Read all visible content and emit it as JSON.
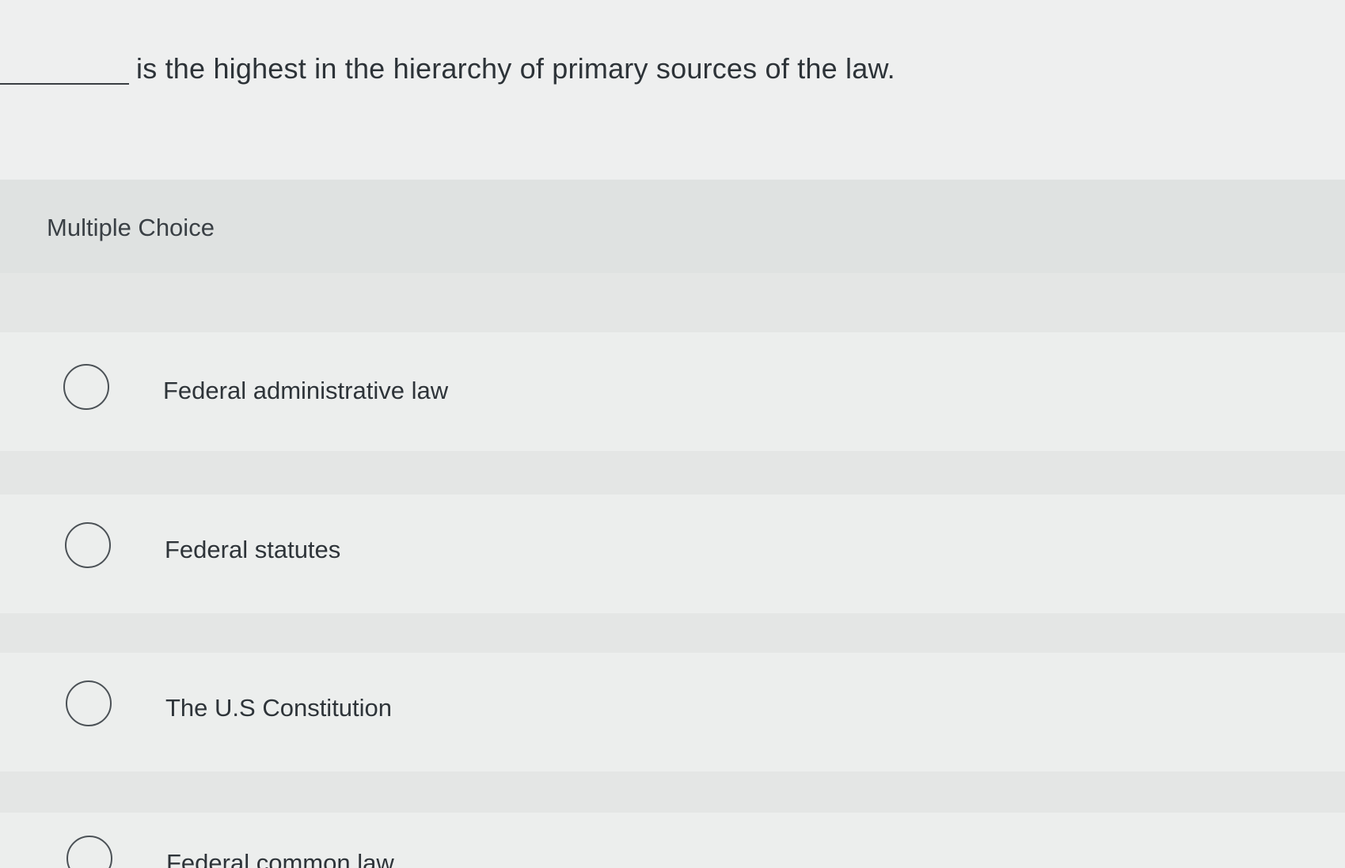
{
  "question": {
    "text": "is the highest in the hierarchy of primary sources of the law."
  },
  "section": {
    "label": "Multiple Choice"
  },
  "options": [
    {
      "label": "Federal administrative law"
    },
    {
      "label": "Federal statutes"
    },
    {
      "label": "The U.S Constitution"
    },
    {
      "label": "Federal common law"
    }
  ]
}
